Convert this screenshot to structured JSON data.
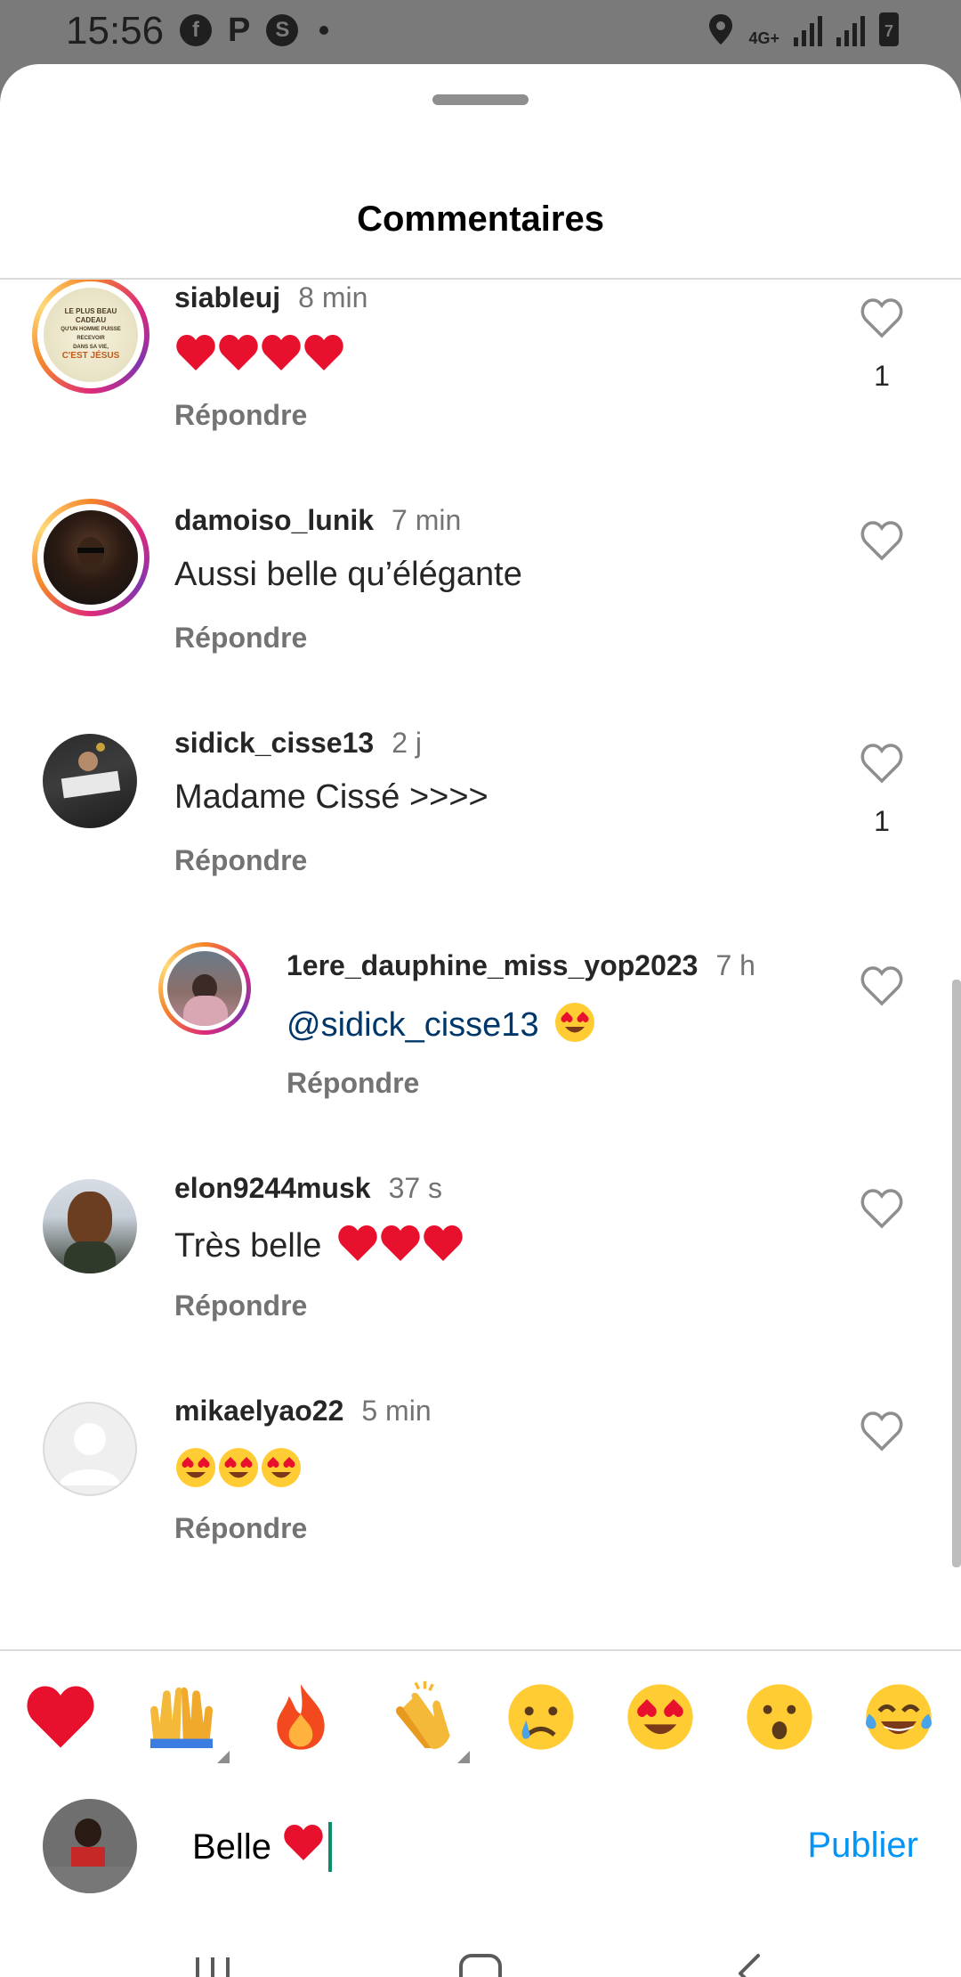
{
  "status_bar": {
    "time": "15:56",
    "network": "4G+",
    "battery": "7"
  },
  "sheet": {
    "title": "Commentaires"
  },
  "comments": [
    {
      "username": "siableuj",
      "time": "8 min",
      "text": "",
      "emoji": [
        "❤️",
        "❤️",
        "❤️",
        "❤️"
      ],
      "reply_label": "Répondre",
      "likes": "1",
      "avatar_text": [
        "LE PLUS BEAU CADEAU",
        "QU'UN HOMME PUISSE RECEVOIR",
        "DANS SA VIE,",
        "C'EST JÉSUS"
      ]
    },
    {
      "username": "damoiso_lunik",
      "time": "7 min",
      "text": "Aussi belle qu’élégante",
      "reply_label": "Répondre",
      "likes": ""
    },
    {
      "username": "sidick_cisse13",
      "time": "2 j",
      "text": "Madame Cissé >>>>",
      "reply_label": "Répondre",
      "likes": "1"
    },
    {
      "username": "1ere_dauphine_miss_yop2023",
      "time": "7 h",
      "mention": "@sidick_cisse13",
      "emoji": [
        "😍"
      ],
      "reply_label": "Répondre",
      "likes": ""
    },
    {
      "username": "elon9244musk",
      "time": "37 s",
      "text": "Très belle",
      "emoji": [
        "❤️",
        "❤️",
        "❤️"
      ],
      "reply_label": "Répondre",
      "likes": ""
    },
    {
      "username": "mikaelyao22",
      "time": "5 min",
      "text": "",
      "emoji": [
        "😍",
        "😍",
        "😍"
      ],
      "reply_label": "Répondre",
      "likes": ""
    }
  ],
  "emoji_bar": [
    "❤️",
    "🙌",
    "🔥",
    "👏",
    "😢",
    "😍",
    "😮",
    "😂"
  ],
  "composer": {
    "value": "Belle",
    "value_emoji": "❤️",
    "publish_label": "Publier"
  },
  "colors": {
    "link_blue": "#0095f6",
    "mention_blue": "#00376b",
    "muted": "#737373"
  }
}
